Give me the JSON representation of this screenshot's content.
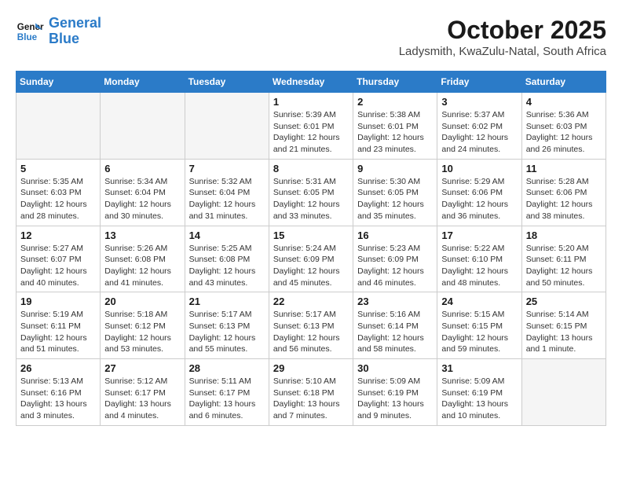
{
  "header": {
    "logo_line1": "General",
    "logo_line2": "Blue",
    "month": "October 2025",
    "location": "Ladysmith, KwaZulu-Natal, South Africa"
  },
  "days_of_week": [
    "Sunday",
    "Monday",
    "Tuesday",
    "Wednesday",
    "Thursday",
    "Friday",
    "Saturday"
  ],
  "weeks": [
    [
      {
        "day": "",
        "info": ""
      },
      {
        "day": "",
        "info": ""
      },
      {
        "day": "",
        "info": ""
      },
      {
        "day": "1",
        "info": "Sunrise: 5:39 AM\nSunset: 6:01 PM\nDaylight: 12 hours\nand 21 minutes."
      },
      {
        "day": "2",
        "info": "Sunrise: 5:38 AM\nSunset: 6:01 PM\nDaylight: 12 hours\nand 23 minutes."
      },
      {
        "day": "3",
        "info": "Sunrise: 5:37 AM\nSunset: 6:02 PM\nDaylight: 12 hours\nand 24 minutes."
      },
      {
        "day": "4",
        "info": "Sunrise: 5:36 AM\nSunset: 6:03 PM\nDaylight: 12 hours\nand 26 minutes."
      }
    ],
    [
      {
        "day": "5",
        "info": "Sunrise: 5:35 AM\nSunset: 6:03 PM\nDaylight: 12 hours\nand 28 minutes."
      },
      {
        "day": "6",
        "info": "Sunrise: 5:34 AM\nSunset: 6:04 PM\nDaylight: 12 hours\nand 30 minutes."
      },
      {
        "day": "7",
        "info": "Sunrise: 5:32 AM\nSunset: 6:04 PM\nDaylight: 12 hours\nand 31 minutes."
      },
      {
        "day": "8",
        "info": "Sunrise: 5:31 AM\nSunset: 6:05 PM\nDaylight: 12 hours\nand 33 minutes."
      },
      {
        "day": "9",
        "info": "Sunrise: 5:30 AM\nSunset: 6:05 PM\nDaylight: 12 hours\nand 35 minutes."
      },
      {
        "day": "10",
        "info": "Sunrise: 5:29 AM\nSunset: 6:06 PM\nDaylight: 12 hours\nand 36 minutes."
      },
      {
        "day": "11",
        "info": "Sunrise: 5:28 AM\nSunset: 6:06 PM\nDaylight: 12 hours\nand 38 minutes."
      }
    ],
    [
      {
        "day": "12",
        "info": "Sunrise: 5:27 AM\nSunset: 6:07 PM\nDaylight: 12 hours\nand 40 minutes."
      },
      {
        "day": "13",
        "info": "Sunrise: 5:26 AM\nSunset: 6:08 PM\nDaylight: 12 hours\nand 41 minutes."
      },
      {
        "day": "14",
        "info": "Sunrise: 5:25 AM\nSunset: 6:08 PM\nDaylight: 12 hours\nand 43 minutes."
      },
      {
        "day": "15",
        "info": "Sunrise: 5:24 AM\nSunset: 6:09 PM\nDaylight: 12 hours\nand 45 minutes."
      },
      {
        "day": "16",
        "info": "Sunrise: 5:23 AM\nSunset: 6:09 PM\nDaylight: 12 hours\nand 46 minutes."
      },
      {
        "day": "17",
        "info": "Sunrise: 5:22 AM\nSunset: 6:10 PM\nDaylight: 12 hours\nand 48 minutes."
      },
      {
        "day": "18",
        "info": "Sunrise: 5:20 AM\nSunset: 6:11 PM\nDaylight: 12 hours\nand 50 minutes."
      }
    ],
    [
      {
        "day": "19",
        "info": "Sunrise: 5:19 AM\nSunset: 6:11 PM\nDaylight: 12 hours\nand 51 minutes."
      },
      {
        "day": "20",
        "info": "Sunrise: 5:18 AM\nSunset: 6:12 PM\nDaylight: 12 hours\nand 53 minutes."
      },
      {
        "day": "21",
        "info": "Sunrise: 5:17 AM\nSunset: 6:13 PM\nDaylight: 12 hours\nand 55 minutes."
      },
      {
        "day": "22",
        "info": "Sunrise: 5:17 AM\nSunset: 6:13 PM\nDaylight: 12 hours\nand 56 minutes."
      },
      {
        "day": "23",
        "info": "Sunrise: 5:16 AM\nSunset: 6:14 PM\nDaylight: 12 hours\nand 58 minutes."
      },
      {
        "day": "24",
        "info": "Sunrise: 5:15 AM\nSunset: 6:15 PM\nDaylight: 12 hours\nand 59 minutes."
      },
      {
        "day": "25",
        "info": "Sunrise: 5:14 AM\nSunset: 6:15 PM\nDaylight: 13 hours\nand 1 minute."
      }
    ],
    [
      {
        "day": "26",
        "info": "Sunrise: 5:13 AM\nSunset: 6:16 PM\nDaylight: 13 hours\nand 3 minutes."
      },
      {
        "day": "27",
        "info": "Sunrise: 5:12 AM\nSunset: 6:17 PM\nDaylight: 13 hours\nand 4 minutes."
      },
      {
        "day": "28",
        "info": "Sunrise: 5:11 AM\nSunset: 6:17 PM\nDaylight: 13 hours\nand 6 minutes."
      },
      {
        "day": "29",
        "info": "Sunrise: 5:10 AM\nSunset: 6:18 PM\nDaylight: 13 hours\nand 7 minutes."
      },
      {
        "day": "30",
        "info": "Sunrise: 5:09 AM\nSunset: 6:19 PM\nDaylight: 13 hours\nand 9 minutes."
      },
      {
        "day": "31",
        "info": "Sunrise: 5:09 AM\nSunset: 6:19 PM\nDaylight: 13 hours\nand 10 minutes."
      },
      {
        "day": "",
        "info": ""
      }
    ]
  ]
}
